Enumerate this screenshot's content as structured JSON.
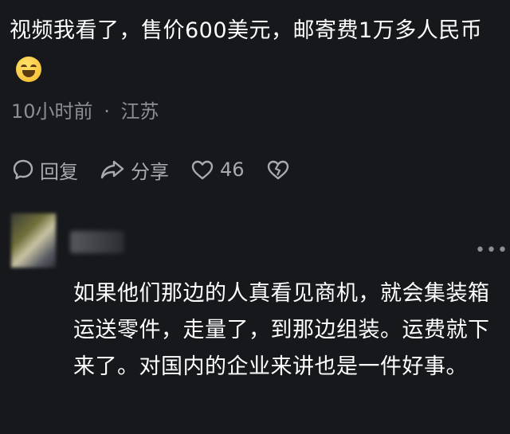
{
  "comment": {
    "text": "视频我看了，售价600美元，邮寄费1万多人民币",
    "emoji": "rolling-on-floor-laughing",
    "time": "10小时前",
    "separator": "·",
    "location": "江苏"
  },
  "actions": {
    "reply_label": "回复",
    "share_label": "分享",
    "like_count": "46"
  },
  "reply": {
    "more": "•••",
    "text": "如果他们那边的人真看见商机，就会集装箱运送零件，走量了，到那边组装。运费就下来了。对国内的企业来讲也是一件好事。"
  }
}
